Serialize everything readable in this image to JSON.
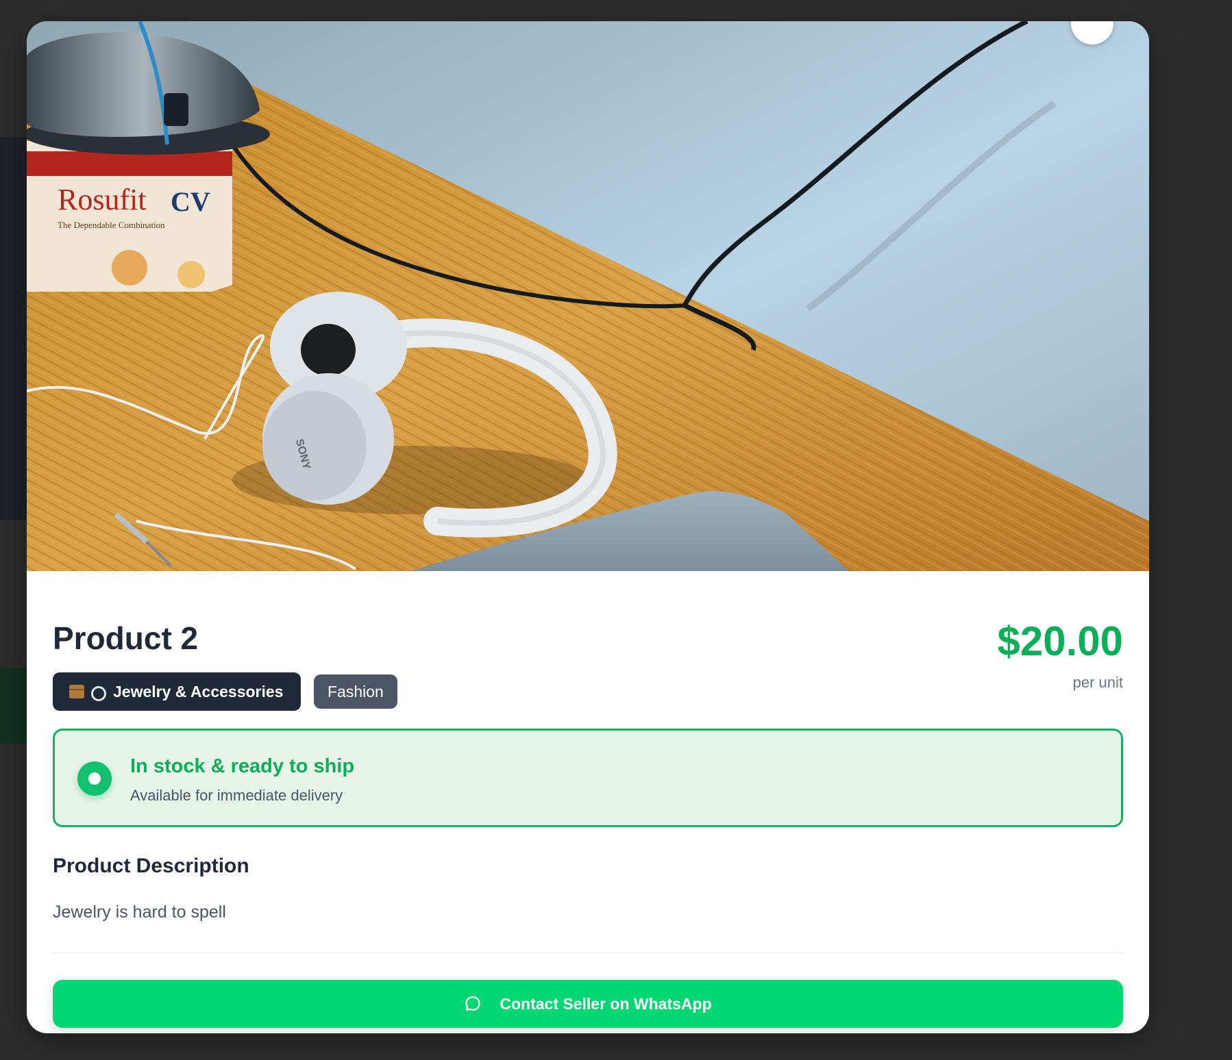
{
  "product": {
    "title": "Product 2",
    "price": "$20.00",
    "price_unit": "per unit",
    "tags": [
      {
        "label": "Jewelry & Accessories",
        "icons": [
          "package-icon",
          "ring-icon"
        ]
      },
      {
        "label": "Fashion"
      }
    ]
  },
  "stock": {
    "title": "In stock & ready to ship",
    "subtitle": "Available for immediate delivery"
  },
  "description": {
    "heading": "Product Description",
    "text": "Jewelry is hard to spell"
  },
  "cta": {
    "label": "Contact Seller on WhatsApp",
    "icon": "chat-bubble-icon"
  },
  "colors": {
    "price": "#0cae5a",
    "cta_background": "#00d672",
    "stock_border": "#12b062",
    "stock_background": "#e7f5e9",
    "primary_tag": "#1f2937",
    "secondary_tag": "#4b5563"
  }
}
